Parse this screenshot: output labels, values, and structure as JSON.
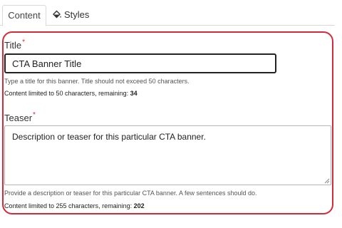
{
  "tabs": [
    {
      "label": "Content",
      "active": true
    },
    {
      "label": "Styles",
      "icon": "paint-bucket-icon"
    }
  ],
  "title_field": {
    "label": "Title",
    "required_mark": "*",
    "value": "CTA Banner Title",
    "help": "Type a title for this banner. Title should not exceed 50 characters.",
    "limit_text": "Content limited to 50 characters, remaining: ",
    "remaining": "34"
  },
  "teaser_field": {
    "label": "Teaser",
    "required_mark": "*",
    "value": "Description or teaser for this particular CTA banner.",
    "help": "Provide a description or teaser for this particular CTA banner. A few sentences should do.",
    "limit_text": "Content limited to 255 characters, remaining: ",
    "remaining": "202"
  },
  "colors": {
    "highlight": "#d42a3a",
    "required": "#d42a3a"
  }
}
